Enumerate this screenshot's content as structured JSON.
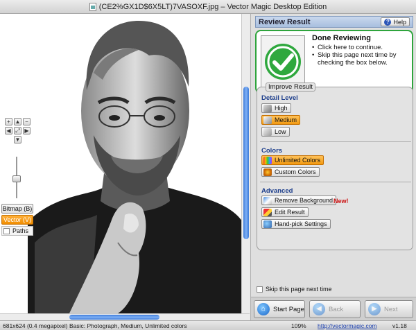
{
  "window": {
    "title": "(CE2%GX1D$6X5LT)7VASOXF.jpg – Vector Magic Desktop Edition"
  },
  "canvas": {
    "nav": {
      "up": "▲",
      "down": "▼",
      "left": "◀",
      "right": "▶",
      "zoom_in": "+",
      "zoom_out": "−",
      "fit": "⤢",
      "actual": "⤡"
    },
    "modes": {
      "bitmap": "Bitmap (B)",
      "vector": "Vector (V)",
      "paths": "Paths"
    }
  },
  "panel": {
    "header": "Review Result",
    "help": "Help",
    "done": {
      "title": "Done Reviewing",
      "bullets": [
        "Click here to continue.",
        "Skip this page next time by checking the box below."
      ]
    },
    "improve": {
      "legend": "Improve Result",
      "detail_level": {
        "label": "Detail Level",
        "options": [
          "High",
          "Medium",
          "Low"
        ],
        "selected": "Medium"
      },
      "colors": {
        "label": "Colors",
        "options": [
          "Unlimited Colors",
          "Custom Colors"
        ],
        "selected": "Unlimited Colors"
      },
      "advanced": {
        "label": "Advanced",
        "remove_bg": "Remove Background",
        "new_tag": "New!",
        "edit": "Edit Result",
        "handpick": "Hand-pick Settings"
      }
    },
    "skip_label": "Skip this page next time",
    "buttons": {
      "start": "Start Page",
      "back": "Back",
      "next": "Next"
    }
  },
  "status": {
    "dimensions": "681x624 (0.4 megapixel)",
    "settings": "Basic: Photograph, Medium, Unlimited colors",
    "zoom": "109%",
    "link": "http://vectormagic.com",
    "version": "v1.18"
  },
  "colors": {
    "accent": "#f39a10",
    "done_border": "#2ea43c",
    "section": "#1e3f8c",
    "scroll": "#3d7bd9",
    "new_tag": "#cc1111"
  },
  "icons": [
    "document-icon",
    "check-icon",
    "help-icon",
    "palette-icon",
    "custom-colors-icon",
    "remove-background-icon",
    "edit-icon",
    "handpick-icon",
    "start-page-icon",
    "back-arrow-icon",
    "next-arrow-icon"
  ]
}
